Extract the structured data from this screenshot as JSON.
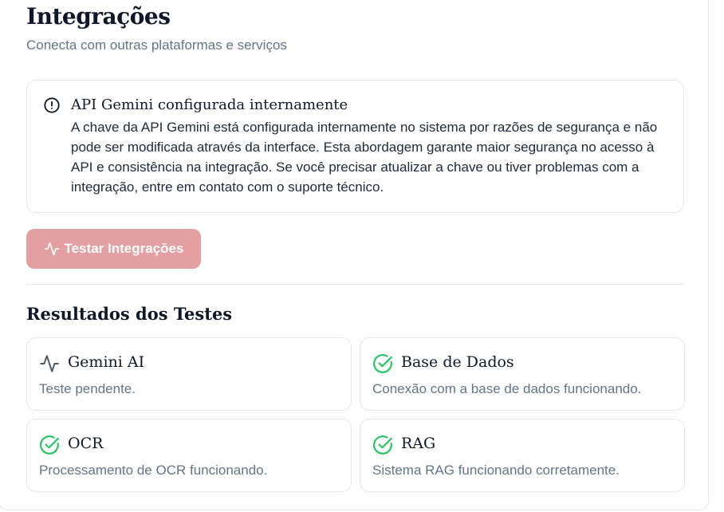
{
  "header": {
    "title": "Integrações",
    "subtitle": "Conecta com outras plataformas e serviços"
  },
  "alert": {
    "icon": "alert-circle-icon",
    "title": "API Gemini configurada internamente",
    "body": "A chave da API Gemini está configurada internamente no sistema por razões de segurança e não pode ser modificada através da interface. Esta abordagem garante maior segurança no acesso à API e consistência na integração. Se você precisar atualizar a chave ou tiver problemas com a integração, entre em contato com o suporte técnico."
  },
  "actions": {
    "test_button_label": "Testar Integrações",
    "test_button_icon": "activity-icon",
    "test_button_color": "#e4a0a0"
  },
  "results": {
    "section_title": "Resultados dos Testes",
    "items": [
      {
        "title": "Gemini AI",
        "description": "Teste pendente.",
        "status": "pending",
        "icon": "activity-icon"
      },
      {
        "title": "Base de Dados",
        "description": "Conexão com a base de dados funcionando.",
        "status": "success",
        "icon": "check-circle-icon"
      },
      {
        "title": "OCR",
        "description": "Processamento de OCR funcionando.",
        "status": "success",
        "icon": "check-circle-icon"
      },
      {
        "title": "RAG",
        "description": "Sistema RAG funcionando corretamente.",
        "status": "success",
        "icon": "check-circle-icon"
      }
    ]
  },
  "colors": {
    "success": "#22c55e",
    "muted_text": "#64748b",
    "border": "#e5e7eb"
  }
}
